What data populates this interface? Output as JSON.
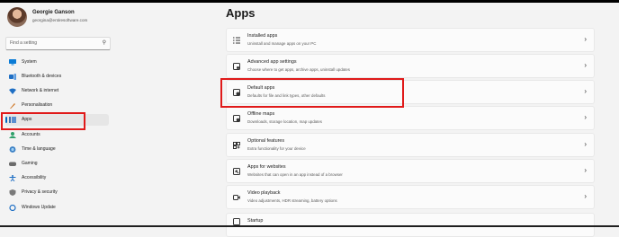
{
  "user": {
    "name": "Georgie Ganson",
    "email": "georgina@entiresoftware.com"
  },
  "search": {
    "placeholder": "Find a setting"
  },
  "sidebar": {
    "items": [
      {
        "label": "System",
        "icon": "system-icon",
        "color": "#0a7bd6"
      },
      {
        "label": "Bluetooth & devices",
        "icon": "bluetooth-icon",
        "color": "#1f6fc4"
      },
      {
        "label": "Network & internet",
        "icon": "network-icon",
        "color": "#1f6fc4"
      },
      {
        "label": "Personalisation",
        "icon": "brush-icon",
        "color": "#d07a2a"
      },
      {
        "label": "Apps",
        "icon": "apps-icon",
        "color": "#3c6fb0",
        "selected": true
      },
      {
        "label": "Accounts",
        "icon": "accounts-icon",
        "color": "#2fa06a"
      },
      {
        "label": "Time & language",
        "icon": "time-language-icon",
        "color": "#3a7fc4"
      },
      {
        "label": "Gaming",
        "icon": "gaming-icon",
        "color": "#6b6b6b"
      },
      {
        "label": "Accessibility",
        "icon": "accessibility-icon",
        "color": "#1f6fc4"
      },
      {
        "label": "Privacy & security",
        "icon": "shield-icon",
        "color": "#6b6b6b"
      },
      {
        "label": "Windows Update",
        "icon": "windows-update-icon",
        "color": "#1f6fc4"
      }
    ]
  },
  "main": {
    "title": "Apps",
    "cards": [
      {
        "title": "Installed apps",
        "desc": "Uninstall and manage apps on your PC",
        "icon": "installed-apps-icon"
      },
      {
        "title": "Advanced app settings",
        "desc": "Choose where to get apps, archive apps, uninstall updates",
        "icon": "advanced-app-settings-icon"
      },
      {
        "title": "Default apps",
        "desc": "Defaults for file and link types, other defaults",
        "icon": "default-apps-icon"
      },
      {
        "title": "Offline maps",
        "desc": "Downloads, storage location, map updates",
        "icon": "offline-maps-icon"
      },
      {
        "title": "Optional features",
        "desc": "Extra functionality for your device",
        "icon": "optional-features-icon"
      },
      {
        "title": "Apps for websites",
        "desc": "Websites that can open in an app instead of a browser",
        "icon": "apps-for-websites-icon"
      },
      {
        "title": "Video playback",
        "desc": "Video adjustments, HDR streaming, battery options",
        "icon": "video-playback-icon"
      },
      {
        "title": "Startup",
        "desc": "",
        "icon": "startup-icon"
      }
    ]
  },
  "colors": {
    "accent": "#0067c0",
    "highlight": "#e01a1a"
  }
}
